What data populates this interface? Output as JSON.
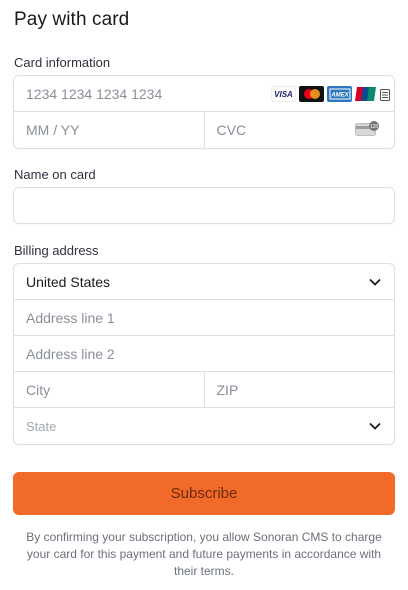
{
  "title": "Pay with card",
  "card_section": {
    "label": "Card information",
    "number_placeholder": "1234 1234 1234 1234",
    "expiry_placeholder": "MM / YY",
    "cvc_placeholder": "CVC",
    "brands": [
      {
        "name": "visa-icon",
        "text": "VISA"
      },
      {
        "name": "mastercard-icon",
        "text": ""
      },
      {
        "name": "amex-icon",
        "text": "AMEX"
      },
      {
        "name": "unionpay-icon",
        "text": "UnionPay"
      }
    ]
  },
  "name_section": {
    "label": "Name on card",
    "value": ""
  },
  "billing_section": {
    "label": "Billing address",
    "country": "United States",
    "address1_placeholder": "Address line 1",
    "address2_placeholder": "Address line 2",
    "city_placeholder": "City",
    "zip_placeholder": "ZIP",
    "state_placeholder": "State"
  },
  "subscribe_label": "Subscribe",
  "terms_text": "By confirming your subscription, you allow Sonoran CMS to charge your card for this payment and future payments in accordance with their terms.",
  "colors": {
    "accent": "#f26a2a",
    "border": "#e0e0e0"
  }
}
